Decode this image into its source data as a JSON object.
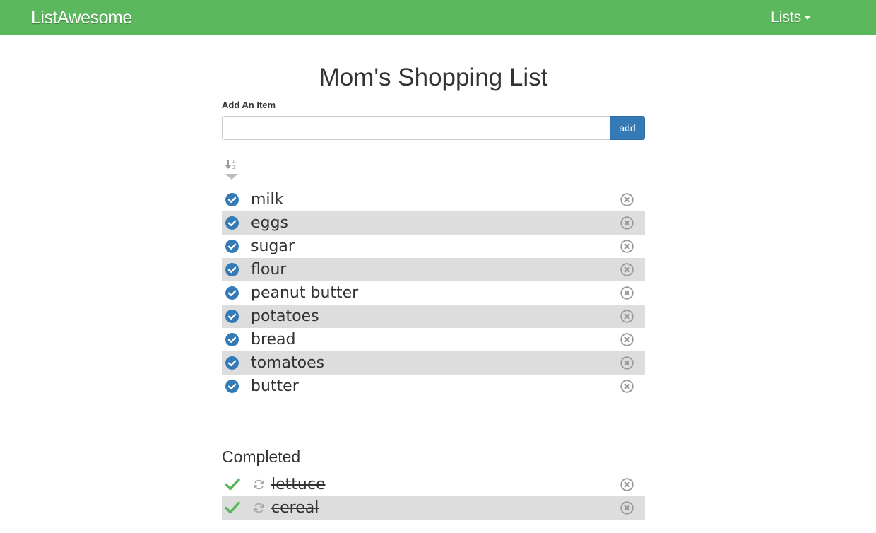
{
  "navbar": {
    "brand": "ListAwesome",
    "lists_menu": "Lists",
    "color": "#5cb85c"
  },
  "page": {
    "title": "Mom's Shopping List"
  },
  "add_form": {
    "label": "Add An Item",
    "input_value": "",
    "placeholder": "",
    "button_label": "add",
    "button_color": "#337ab7"
  },
  "sort": {
    "icon": "sort-alpha-icon"
  },
  "items": [
    {
      "label": "milk"
    },
    {
      "label": "eggs"
    },
    {
      "label": "sugar"
    },
    {
      "label": "flour"
    },
    {
      "label": "peanut butter"
    },
    {
      "label": "potatoes"
    },
    {
      "label": "bread"
    },
    {
      "label": "tomatoes"
    },
    {
      "label": "butter"
    }
  ],
  "completed": {
    "heading": "Completed",
    "items": [
      {
        "label": "lettuce"
      },
      {
        "label": "cereal"
      }
    ]
  },
  "colors": {
    "check_blue": "#337ab7",
    "done_green": "#5cb85c",
    "stripe": "#dddddd",
    "remove_gray": "#9a9a9a"
  }
}
